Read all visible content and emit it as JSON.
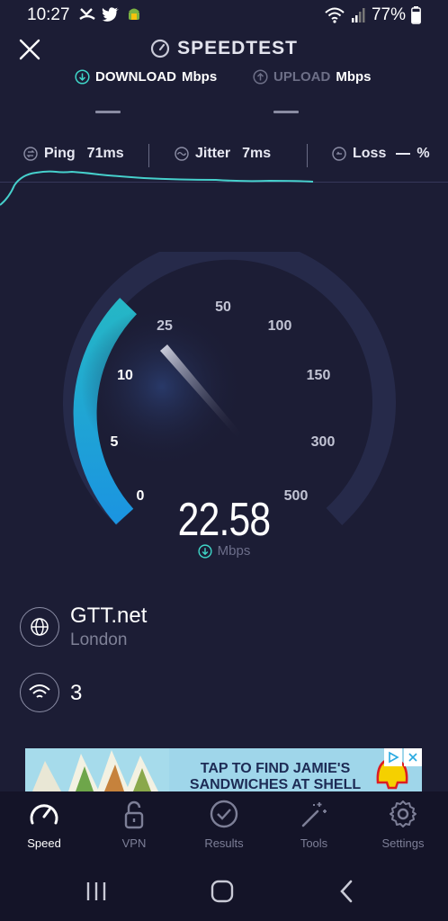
{
  "status_bar": {
    "time": "10:27",
    "battery": "77%"
  },
  "header": {
    "title": "SPEEDTEST",
    "download_label": "DOWNLOAD",
    "download_unit": "Mbps",
    "upload_label": "UPLOAD",
    "upload_unit": "Mbps"
  },
  "metrics": {
    "ping_label": "Ping",
    "ping_value": "71ms",
    "jitter_label": "Jitter",
    "jitter_value": "7ms",
    "loss_label": "Loss",
    "loss_value": "%"
  },
  "gauge": {
    "ticks": [
      "0",
      "5",
      "10",
      "25",
      "50",
      "100",
      "150",
      "300",
      "500"
    ],
    "current_value": "22.58",
    "unit": "Mbps",
    "accent_color": "#20a8d8",
    "track_color": "#262a4a"
  },
  "server": {
    "name": "GTT.net",
    "location": "London"
  },
  "network": {
    "name": "3"
  },
  "ad": {
    "headline": "TAP TO FIND JAMIE'S SANDWICHES AT SHELL"
  },
  "nav": {
    "items": [
      {
        "label": "Speed",
        "icon": "speedometer-icon"
      },
      {
        "label": "VPN",
        "icon": "lock-icon"
      },
      {
        "label": "Results",
        "icon": "check-circle-icon"
      },
      {
        "label": "Tools",
        "icon": "magic-wand-icon"
      },
      {
        "label": "Settings",
        "icon": "gear-icon"
      }
    ]
  }
}
